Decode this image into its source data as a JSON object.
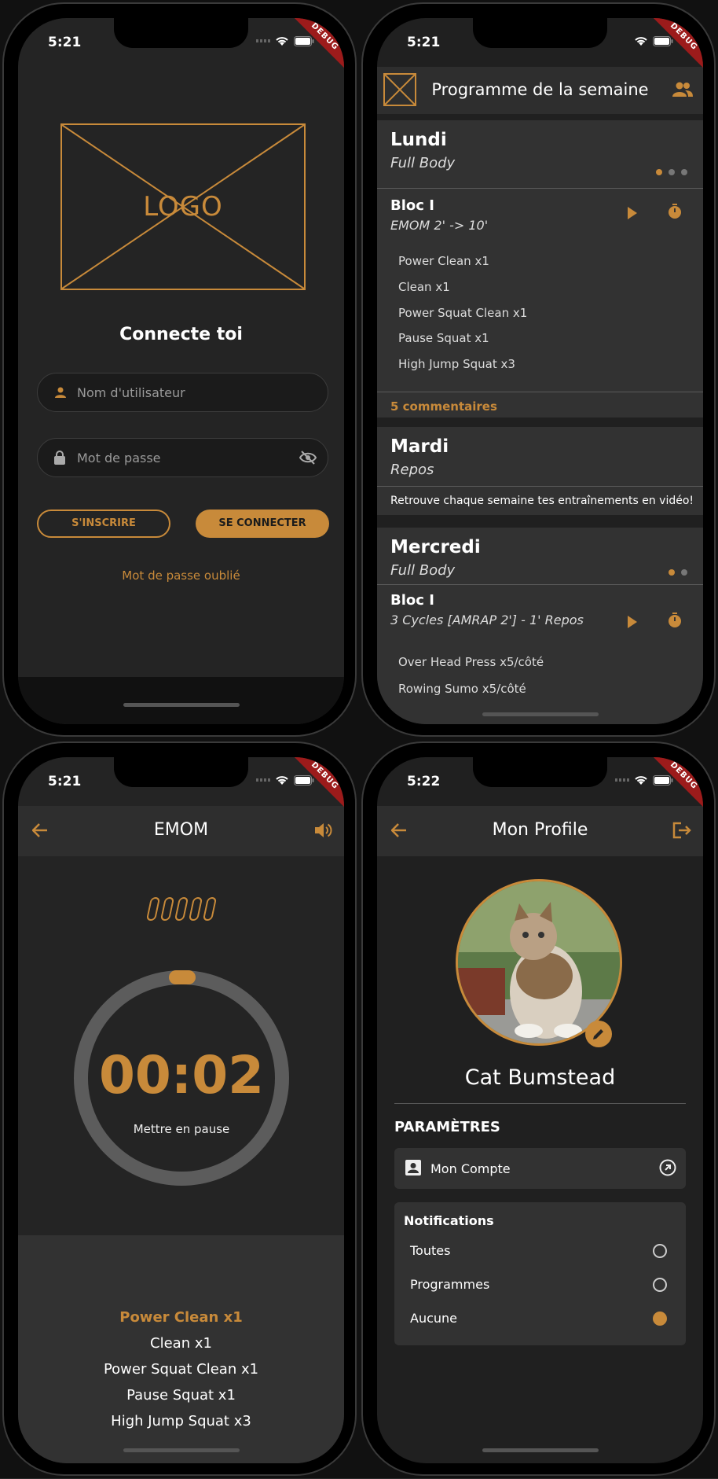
{
  "status": {
    "time_login": "5:21",
    "time_program": "5:21",
    "time_emom": "5:21",
    "time_profile": "5:22",
    "debug_label": "DEBUG"
  },
  "login": {
    "logo_text": "LOGO",
    "title": "Connecte toi",
    "username_placeholder": "Nom d'utilisateur",
    "password_placeholder": "Mot de passe",
    "register_label": "S'INSCRIRE",
    "login_label": "SE CONNECTER",
    "forgot_label": "Mot de passe oublié"
  },
  "program": {
    "title": "Programme de la semaine",
    "days": [
      {
        "name": "Lundi",
        "type": "Full Body",
        "bloc_title": "Bloc I",
        "bloc_sub": "EMOM 2' -> 10'",
        "exercises": [
          "Power Clean x1",
          "Clean x1",
          "Power Squat Clean x1",
          "Pause Squat x1",
          "High Jump Squat x3"
        ],
        "comments": "5 commentaires"
      },
      {
        "name": "Mardi",
        "type": "Repos",
        "info": "Retrouve chaque semaine tes entraînements en vidéo!"
      },
      {
        "name": "Mercredi",
        "type": "Full Body",
        "bloc_title": "Bloc I",
        "bloc_sub": "3 Cycles [AMRAP 2'] - 1' Repos",
        "exercises": [
          "Over Head Press x5/côté",
          "Rowing Sumo x5/côté"
        ]
      }
    ]
  },
  "emom": {
    "title": "EMOM",
    "timer": "00:02",
    "pause_label": "Mettre en pause",
    "exercises": [
      "Power Clean x1",
      "Clean x1",
      "Power Squat Clean x1",
      "Pause Squat x1",
      "High Jump Squat x3"
    ]
  },
  "profile": {
    "title": "Mon Profile",
    "name": "Cat Bumstead",
    "section_title": "PARAMÈTRES",
    "account_label": "Mon Compte",
    "notifications_title": "Notifications",
    "options": [
      "Toutes",
      "Programmes",
      "Aucune"
    ],
    "selected_option": "Aucune"
  },
  "colors": {
    "accent": "#c88a3a",
    "background": "#242424",
    "surface": "#323232",
    "debug_banner": "#9c1b1b"
  }
}
